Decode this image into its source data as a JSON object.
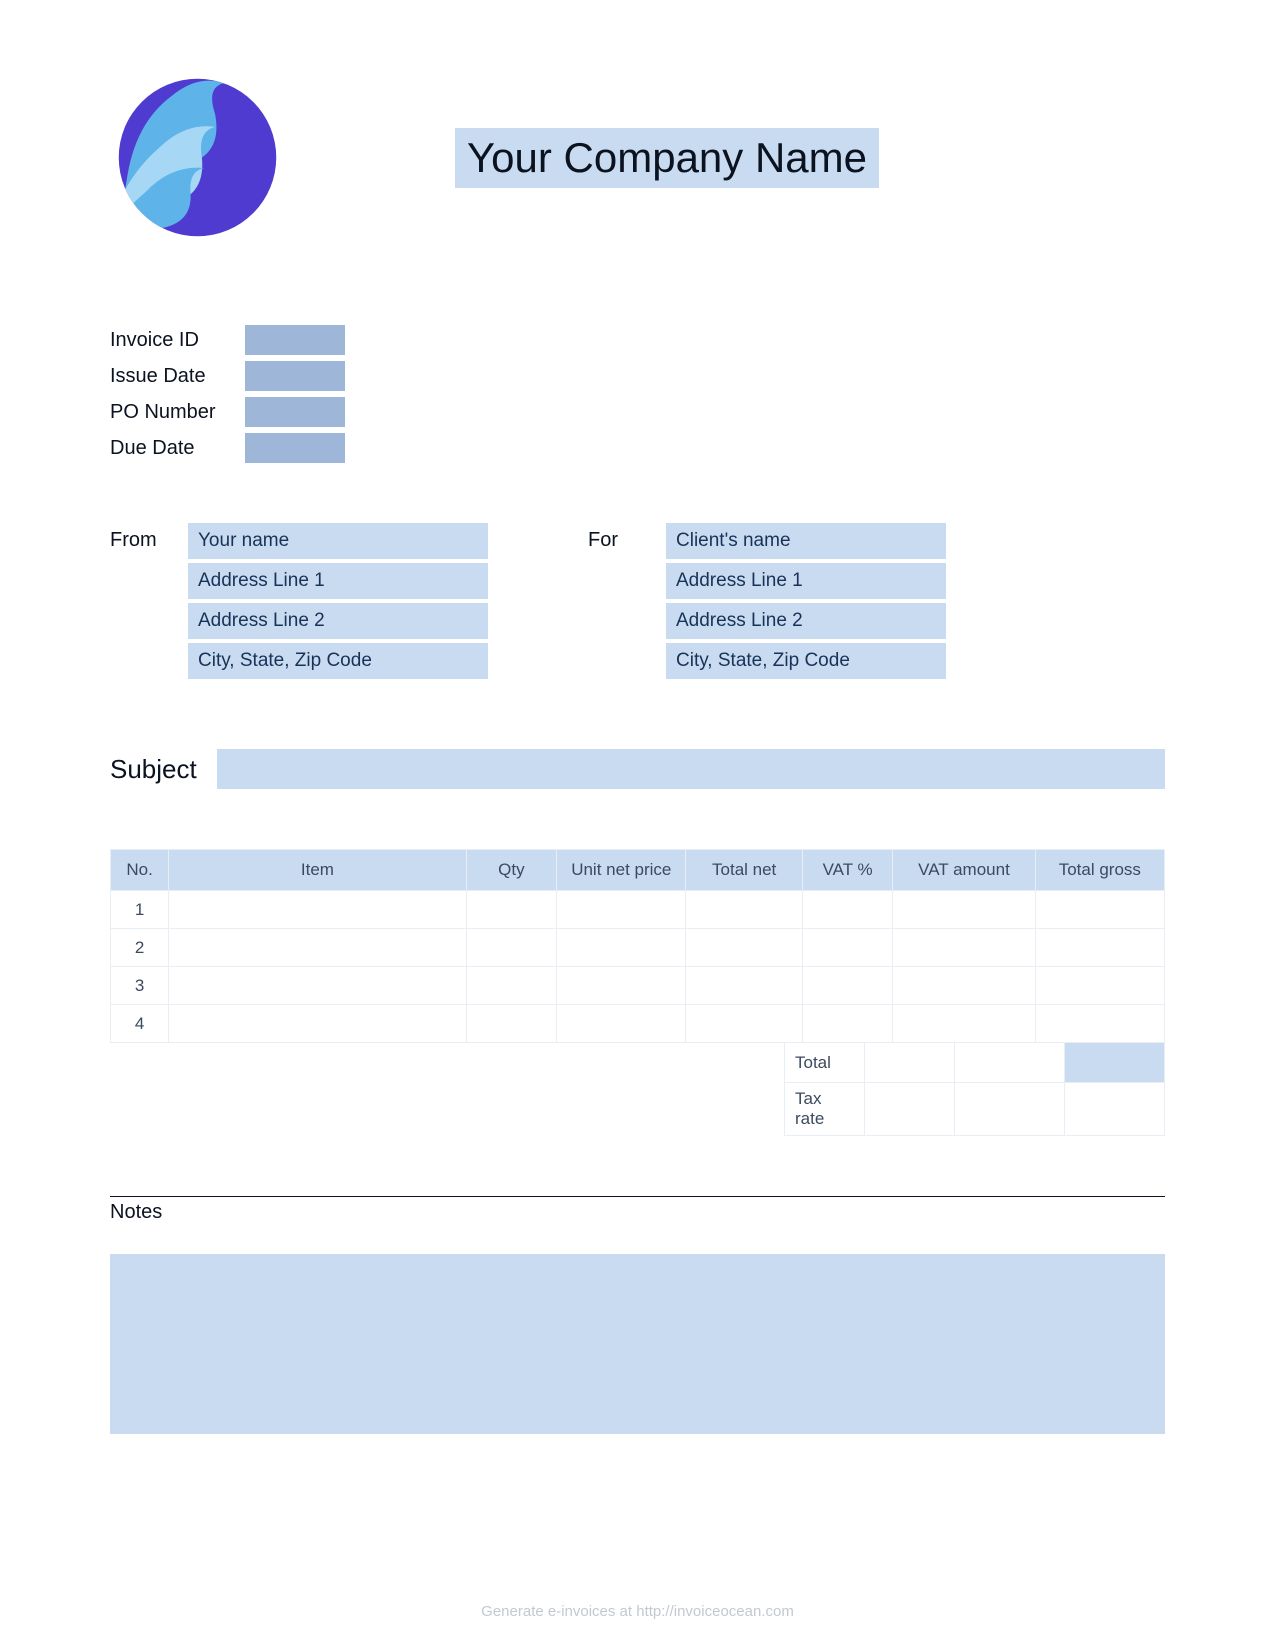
{
  "company_name": "Your Company Name",
  "meta": {
    "invoice_id_label": "Invoice ID",
    "issue_date_label": "Issue Date",
    "po_number_label": "PO Number",
    "due_date_label": "Due Date"
  },
  "from": {
    "label": "From",
    "name": "Your name",
    "address1": "Address Line 1",
    "address2": "Address Line 2",
    "city": "City, State, Zip Code"
  },
  "for": {
    "label": "For",
    "name": "Client's name",
    "address1": "Address Line 1",
    "address2": "Address Line 2",
    "city": "City, State, Zip Code"
  },
  "subject_label": "Subject",
  "table": {
    "headers": {
      "no": "No.",
      "item": "Item",
      "qty": "Qty",
      "unit": "Unit net price",
      "totalnet": "Total net",
      "vatpct": "VAT %",
      "vatamt": "VAT amount",
      "totalgross": "Total gross"
    },
    "rows": [
      "1",
      "2",
      "3",
      "4"
    ]
  },
  "summary": {
    "total_label": "Total",
    "tax_label": "Tax rate"
  },
  "notes_label": "Notes",
  "footer_text": "Generate e-invoices at http://invoiceocean.com"
}
